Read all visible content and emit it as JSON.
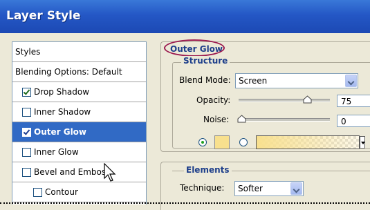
{
  "window": {
    "title": "Layer Style"
  },
  "styles_list": {
    "header": "Styles",
    "blending": "Blending Options: Default",
    "items": [
      {
        "label": "Drop Shadow",
        "checked": true,
        "selected": false
      },
      {
        "label": "Inner Shadow",
        "checked": false,
        "selected": false
      },
      {
        "label": "Outer Glow",
        "checked": true,
        "selected": true
      },
      {
        "label": "Inner Glow",
        "checked": false,
        "selected": false
      },
      {
        "label": "Bevel and Emboss",
        "checked": false,
        "selected": false
      },
      {
        "label": "Contour",
        "checked": false,
        "selected": false
      }
    ]
  },
  "outer_glow": {
    "title": "Outer Glow",
    "structure": {
      "title": "Structure",
      "blend_mode_label": "Blend Mode:",
      "blend_mode_value": "Screen",
      "opacity_label": "Opacity:",
      "opacity_value": "75",
      "opacity_unit": "%",
      "opacity_fraction": 0.75,
      "noise_label": "Noise:",
      "noise_value": "0",
      "noise_unit": "%",
      "noise_fraction": 0.0,
      "color_mode": "solid",
      "glow_color": "#f8e08e"
    },
    "elements": {
      "title": "Elements",
      "technique_label": "Technique:",
      "technique_value": "Softer"
    }
  },
  "colors": {
    "title_bar": "#2457c5",
    "selection": "#316ac5",
    "group_title": "#1d3e8a",
    "highlight_oval": "#9b1a4f"
  }
}
